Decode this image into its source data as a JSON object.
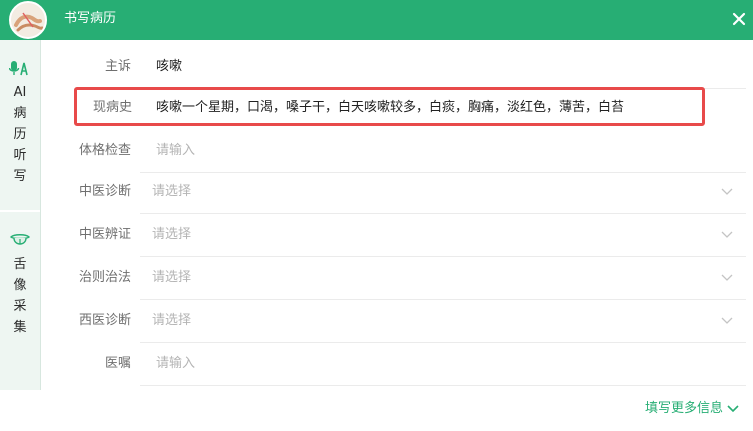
{
  "window": {
    "title": "书写病历"
  },
  "sidebar": {
    "ai_dictation": {
      "label": "AI病历听写",
      "chars": [
        "AI",
        "病",
        "历",
        "听",
        "写"
      ]
    },
    "tongue_capture": {
      "label": "舌像采集",
      "chars": [
        "舌",
        "像",
        "采",
        "集"
      ]
    }
  },
  "form": {
    "chief_complaint": {
      "label": "主诉",
      "value": "咳嗽"
    },
    "present_illness": {
      "label": "现病史",
      "value": "咳嗽一个星期，口渴，嗓子干，白天咳嗽较多，白痰，胸痛，淡红色，薄苦，白苔"
    },
    "physical_exam": {
      "label": "体格检查",
      "placeholder": "请输入"
    },
    "tcm_diagnosis": {
      "label": "中医诊断",
      "placeholder": "请选择"
    },
    "tcm_syndrome": {
      "label": "中医辨证",
      "placeholder": "请选择"
    },
    "treatment_principle": {
      "label": "治则治法",
      "placeholder": "请选择"
    },
    "western_diagnosis": {
      "label": "西医诊断",
      "placeholder": "请选择"
    },
    "doctor_advice": {
      "label": "医嘱",
      "placeholder": "请输入"
    }
  },
  "footer": {
    "more_link": "填写更多信息"
  },
  "colors": {
    "brand": "#27ae74",
    "highlight": "#e84a4a",
    "sidebar_bg": "#eef6f2"
  }
}
